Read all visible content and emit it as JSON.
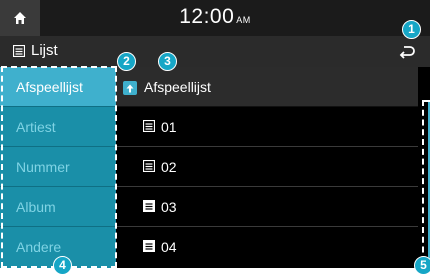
{
  "status_bar": {
    "time": "12:00",
    "ampm": "AM"
  },
  "title_bar": {
    "title": "Lijst"
  },
  "sidebar": {
    "items": [
      {
        "label": "Afspeellijst",
        "active": true
      },
      {
        "label": "Artiest",
        "active": false
      },
      {
        "label": "Nummer",
        "active": false
      },
      {
        "label": "Album",
        "active": false
      },
      {
        "label": "Andere",
        "active": false
      }
    ]
  },
  "list": {
    "header": "Afspeellijst",
    "rows": [
      {
        "label": "01"
      },
      {
        "label": "02"
      },
      {
        "label": "03"
      },
      {
        "label": "04"
      }
    ]
  },
  "callouts": [
    "1",
    "2",
    "3",
    "4",
    "5"
  ],
  "colors": {
    "accent": "#3fb0cd",
    "sidebar": "#1a8fa8",
    "callout": "#16a6c6"
  }
}
